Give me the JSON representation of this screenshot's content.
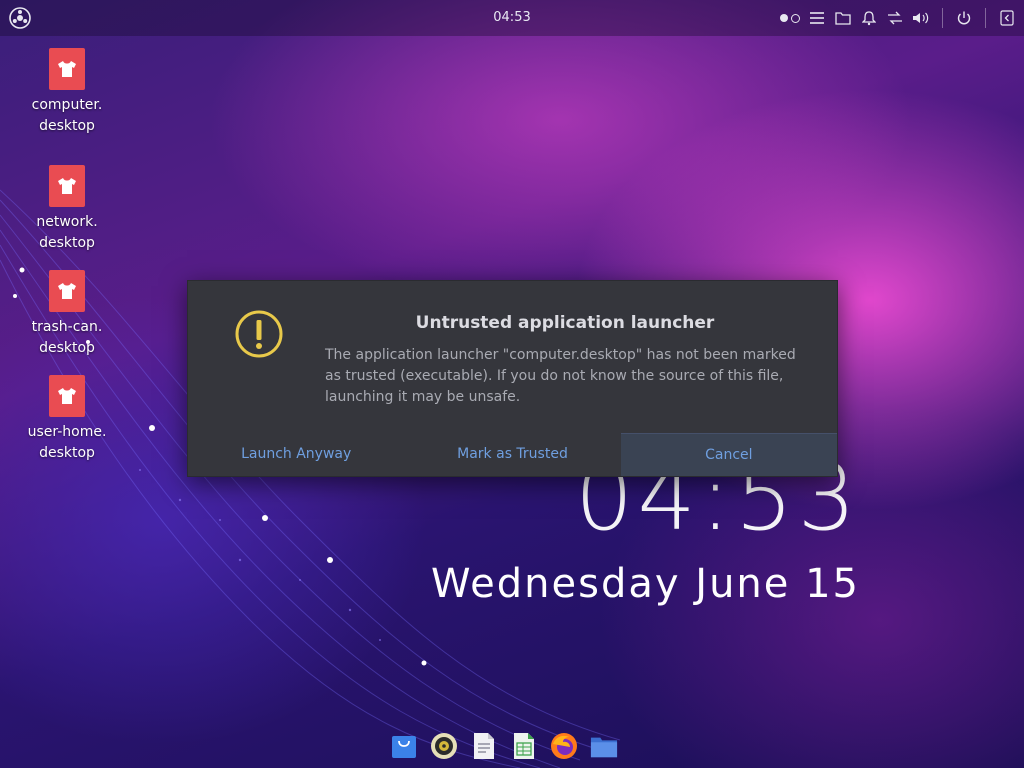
{
  "top_panel": {
    "clock": "04:53",
    "logo_icon": "distro-logo-icon",
    "tray_icons": [
      "workspace-indicator",
      "menu-icon",
      "files-icon",
      "notification-bell-icon",
      "network-icon",
      "volume-icon",
      "power-icon",
      "collapse-panel-icon"
    ]
  },
  "desktop_icons": [
    {
      "line1": "computer.",
      "line2": "desktop",
      "icon": "shirt-icon"
    },
    {
      "line1": "network.",
      "line2": "desktop",
      "icon": "shirt-icon"
    },
    {
      "line1": "trash-can.",
      "line2": "desktop",
      "icon": "shirt-icon"
    },
    {
      "line1": "user-home.",
      "line2": "desktop",
      "icon": "shirt-icon"
    }
  ],
  "wallpaper": {
    "clock": "04:53",
    "date": "Wednesday June 15"
  },
  "dialog": {
    "title": "Untrusted application launcher",
    "message": "The application launcher \"computer.desktop\" has not been marked as trusted (executable). If you do not know the source of this file, launching it may be unsafe.",
    "buttons": {
      "launch": "Launch Anyway",
      "trust": "Mark as Trusted",
      "cancel": "Cancel"
    },
    "warning_color": "#e8c94a",
    "accent_color": "#6f9fe0"
  },
  "dock": {
    "apps": [
      "shopping-bag-icon",
      "music-player-icon",
      "text-editor-icon",
      "spreadsheet-icon",
      "firefox-icon",
      "files-folder-icon"
    ]
  }
}
